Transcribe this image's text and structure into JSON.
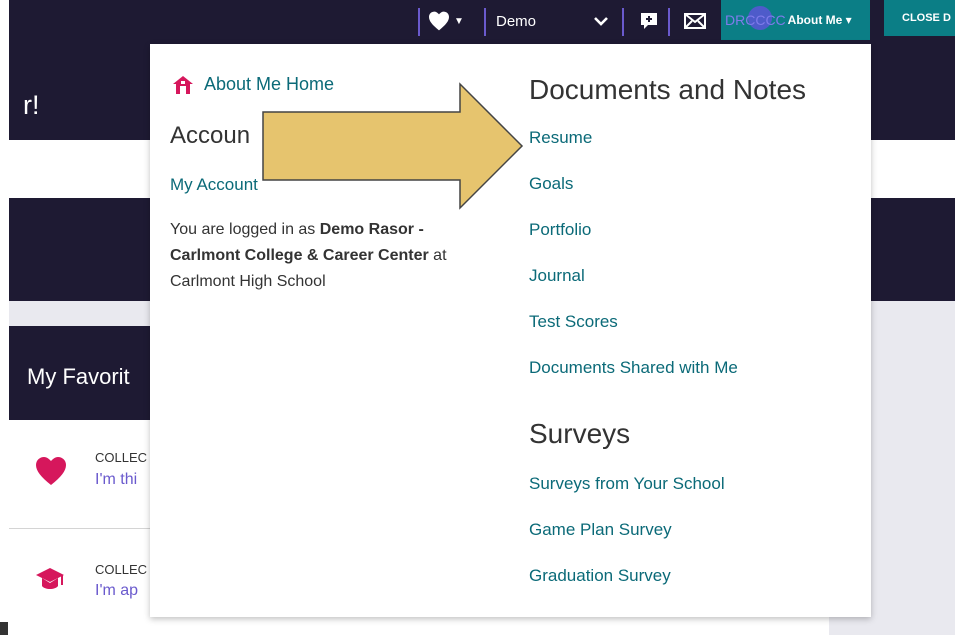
{
  "page": {
    "hero_title_partial": "r!",
    "favorites_title_partial": "My Favorit",
    "favorites": [
      {
        "category_partial": "COLLEC",
        "text_partial": "I'm thi",
        "icon": "heart-icon"
      },
      {
        "category_partial": "COLLEC",
        "text_partial": "I'm ap",
        "icon": "graduation-cap-icon"
      }
    ]
  },
  "topnav": {
    "demo_select_value": "Demo",
    "avatar_initials": "DRCCCC",
    "about_me_label": "About Me ▾",
    "close_label": "CLOSE D"
  },
  "dropdown": {
    "home_link": "About Me Home",
    "account_heading": "Accoun",
    "my_account_link": "My Account",
    "logged_in": {
      "prefix": "You are logged in as ",
      "user": "Demo Rasor - Carlmont College & Career Center",
      "middle": " at ",
      "school": "Carlmont High School"
    },
    "documents_heading": "Documents and Notes",
    "documents_links": [
      "Resume",
      "Goals",
      "Portfolio",
      "Journal",
      "Test Scores",
      "Documents Shared with Me"
    ],
    "surveys_heading": "Surveys",
    "surveys_links": [
      "Surveys from Your School",
      "Game Plan Survey",
      "Graduation Survey"
    ]
  },
  "colors": {
    "navy": "#1e1a33",
    "teal": "#0b7e86",
    "link": "#0b6a78",
    "pink": "#d6175c",
    "arrow_fill": "#e6c46e"
  }
}
